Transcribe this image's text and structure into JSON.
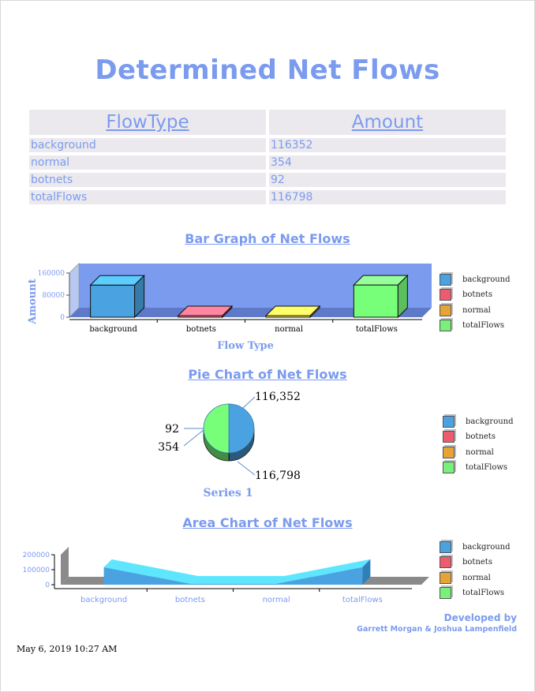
{
  "title": "Determined Net Flows",
  "table": {
    "headers": [
      "FlowType",
      "Amount"
    ],
    "rows": [
      {
        "type": "background",
        "amount": "116352"
      },
      {
        "type": "normal",
        "amount": "354"
      },
      {
        "type": "botnets",
        "amount": "92"
      },
      {
        "type": "totalFlows",
        "amount": "116798"
      }
    ]
  },
  "legend": [
    {
      "label": "background",
      "color": "#4aa3e0"
    },
    {
      "label": "botnets",
      "color": "#ec5b6e"
    },
    {
      "label": "normal",
      "color": "#e6a336"
    },
    {
      "label": "totalFlows",
      "color": "#78f07a"
    }
  ],
  "colors": {
    "accent": "#7b9bef",
    "bar_plot_bg": "#7b9bef"
  },
  "chart_data": [
    {
      "type": "bar",
      "title": "Bar Graph of Net Flows",
      "categories": [
        "background",
        "botnets",
        "normal",
        "totalFlows"
      ],
      "values": [
        116352,
        92,
        354,
        116798
      ],
      "colors": [
        "#4aa3e0",
        "#ff6b81",
        "#ffee55",
        "#78ff7a"
      ],
      "xlabel": "Flow Type",
      "ylabel": "Amount",
      "yticks": [
        0,
        80000,
        160000
      ],
      "ytick_labels": [
        "0",
        "80000",
        "160000"
      ],
      "ylim": [
        0,
        160000
      ],
      "grid": false,
      "legend": "right"
    },
    {
      "type": "pie",
      "title": "Pie Chart of Net Flows",
      "labels": [
        "background",
        "botnets",
        "normal",
        "totalFlows"
      ],
      "values": [
        116352,
        92,
        354,
        116798
      ],
      "value_labels": [
        "116,352",
        "92",
        "354",
        "116,798"
      ],
      "colors": [
        "#4aa3e0",
        "#ec5b6e",
        "#e6a336",
        "#78ff7a"
      ],
      "series_name": "Series 1",
      "legend": "right"
    },
    {
      "type": "area",
      "title": "Area Chart of Net Flows",
      "categories": [
        "background",
        "botnets",
        "normal",
        "totalFlows"
      ],
      "values": [
        116352,
        92,
        354,
        116798
      ],
      "yticks": [
        0,
        100000,
        200000
      ],
      "ytick_labels": [
        "0",
        "100000",
        "200000"
      ],
      "ylim": [
        0,
        200000
      ],
      "legend": "right"
    }
  ],
  "credit": {
    "line1": "Developed by",
    "line2": "Garrett Morgan & Joshua Lampenfield"
  },
  "date": "May 6, 2019 10:27 AM"
}
